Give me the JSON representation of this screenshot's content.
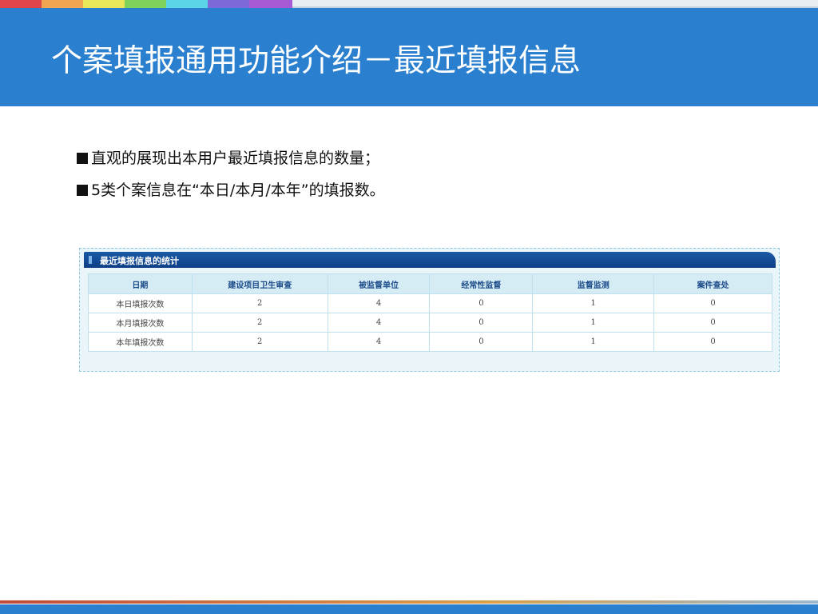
{
  "title": "个案填报通用功能介绍－最近填报信息",
  "bullets": [
    "直观的展现出本用户最近填报信息的数量；",
    "5类个案信息在“本日/本月/本年”的填报数。"
  ],
  "panel": {
    "header": "最近填报信息的统计",
    "columns": [
      "日期",
      "建设项目卫生审查",
      "被监督单位",
      "经常性监督",
      "监督监测",
      "案件查处"
    ],
    "rows": [
      {
        "label": "本日填报次数",
        "values": [
          "2",
          "4",
          "0",
          "1",
          "0"
        ]
      },
      {
        "label": "本月填报次数",
        "values": [
          "2",
          "4",
          "0",
          "1",
          "0"
        ]
      },
      {
        "label": "本年填报次数",
        "values": [
          "2",
          "4",
          "0",
          "1",
          "0"
        ]
      }
    ]
  },
  "colors": {
    "header_bg": "#2a80cf",
    "panel_bar": "#0d3f86",
    "table_header_bg": "#d6ecf5"
  }
}
